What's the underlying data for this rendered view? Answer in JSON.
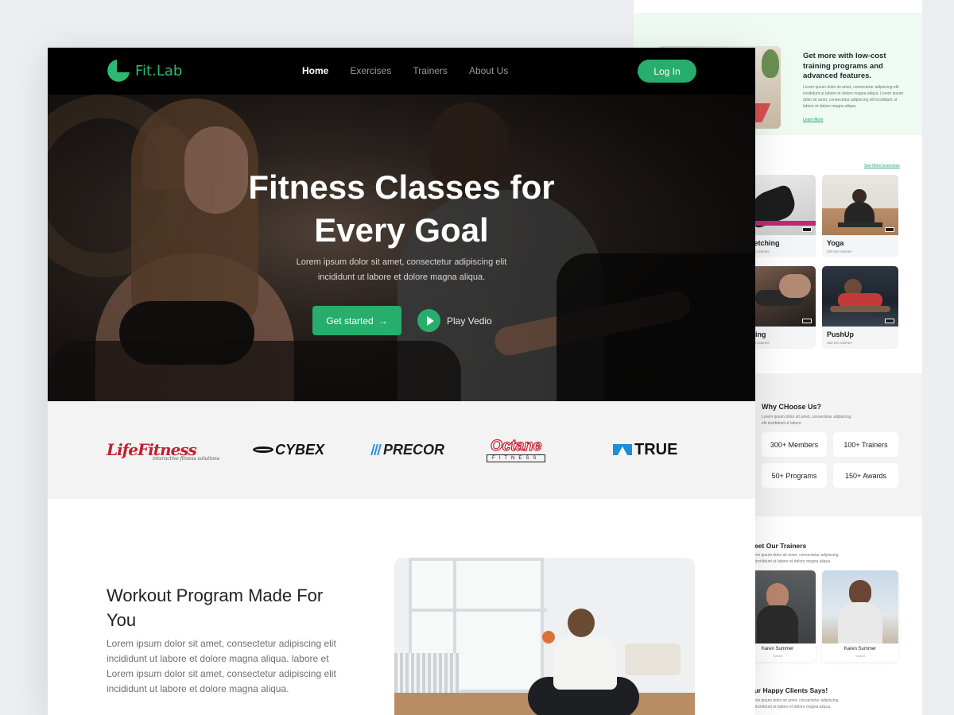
{
  "colors": {
    "brand_green": "#27ae6c",
    "nav_bg": "#000000",
    "page_bg": "#eceef1"
  },
  "nav": {
    "logo_text": "Fit.Lab",
    "logo_icon": "leaf-pie-logo-icon",
    "links": [
      "Home",
      "Exercises",
      "Trainers",
      "About Us"
    ],
    "active_link": "Home",
    "login_label": "Log In"
  },
  "hero": {
    "title_line1": "Fitness Classes for",
    "title_line2": "Every Goal",
    "subtitle": "Lorem ipsum dolor sit amet, consectetur adipiscing elit incididunt ut labore et dolore magna aliqua.",
    "primary_button": "Get started",
    "primary_button_icon": "arrow-right-icon",
    "play_label": "Play Vedio",
    "play_icon": "play-icon"
  },
  "brands": {
    "life_fitness": "LifeFitness",
    "life_fitness_tagline": "interactive fitness solutions",
    "cybex": "CYBEX",
    "precor": "PRECOR",
    "octane": "Octane",
    "octane_sub": "FITNESS",
    "true": "TRUE"
  },
  "program": {
    "title": "Workout Program Made For You",
    "text": "Lorem ipsum dolor sit amet, consectetur adipiscing elit incididunt ut labore et dolore magna aliqua.  labore et Lorem ipsum dolor sit amet, consectetur adipiscing elit incididunt ut labore et dolore magna aliqua."
  },
  "background_page": {
    "promo": {
      "title": "Get more with low-cost training programs and advanced features.",
      "text": "Lorem ipsum dolor sit amet, consectetur adipiscing elit incididunt ut labore et dolore magna aliqua. Lorem ipsum dolor sit amet, consectetur adipiscing elit incididunt ut labore et dolore magna aliqua.",
      "link": "Learn More"
    },
    "exercises": {
      "see_more": "See More Exercises",
      "items": [
        {
          "name": "Stretching",
          "sub": "250 est calories"
        },
        {
          "name": "Yoga",
          "sub": "250 est calories"
        },
        {
          "name": "Lifting",
          "sub": "250 est calories"
        },
        {
          "name": "PushUp",
          "sub": "250 est calories"
        }
      ]
    },
    "why": {
      "title": "Why CHoose Us?",
      "text": "Lorem ipsum dolor sit amet, consectetur adipiscing elit incididunt ut labore",
      "stats": [
        "300+ Members",
        "100+ Trainers",
        "50+ Programs",
        "150+ Awards"
      ]
    },
    "trainers": {
      "title": "Meet Our Trainers",
      "text": "Lorem ipsum dolor sit amet, consectetur adipiscing elit incididunt ut labore et dolore magna aliqua.",
      "items": [
        {
          "name": "Karen Summer",
          "role": "Trainer"
        },
        {
          "name": "Karen Summer",
          "role": "Trainer"
        }
      ]
    },
    "clients": {
      "title": "Our Happy Clients Says!",
      "text": "Lorem ipsum dolor sit amet, consectetur adipiscing elit incididunt ut labore et dolore magna aliqua."
    }
  }
}
